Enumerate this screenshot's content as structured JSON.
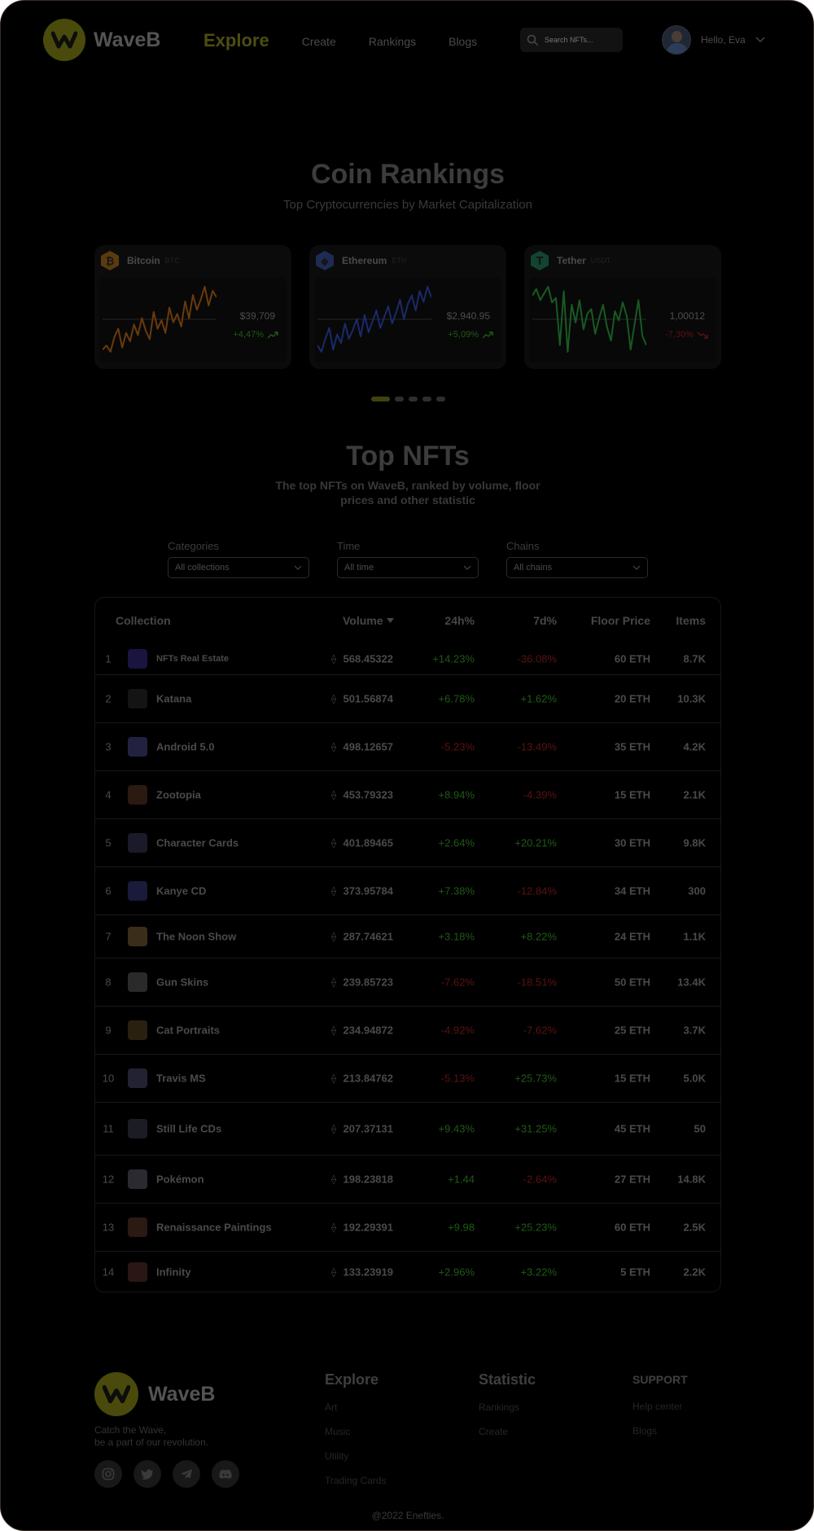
{
  "brand": {
    "name": "WaveB"
  },
  "nav": {
    "items": [
      {
        "label": "Explore",
        "active": true
      },
      {
        "label": "Create",
        "active": false
      },
      {
        "label": "Rankings",
        "active": false
      },
      {
        "label": "Blogs",
        "active": false
      }
    ],
    "search_placeholder": "Search NFTs..."
  },
  "user": {
    "greeting": "Hello, Eva"
  },
  "coin_section": {
    "title": "Coin Rankings",
    "subtitle": "Top Cryptocurrencies by Market Capitalization"
  },
  "coins": [
    {
      "name": "Bitcoin",
      "symbol": "BTC",
      "icon": "bitcoin-icon",
      "price": "$39,709",
      "change": "+4,47%",
      "direction": "up",
      "color": "#6a3a0c",
      "icon_bg": "#5a3a0e",
      "icon_glyph": "₿",
      "spark": [
        10,
        14,
        8,
        22,
        30,
        12,
        26,
        18,
        34,
        24,
        40,
        28,
        20,
        46,
        30,
        38,
        26,
        50,
        36,
        44,
        32,
        56,
        40,
        62,
        48,
        58,
        70,
        52,
        66,
        60
      ]
    },
    {
      "name": "Ethereum",
      "symbol": "ETH",
      "icon": "ethereum-icon",
      "price": "$2,940.95",
      "change": "+5,09%",
      "direction": "up",
      "color": "#1a2a6a",
      "icon_bg": "#1f2a55",
      "icon_glyph": "◆",
      "spark": [
        14,
        8,
        20,
        30,
        10,
        24,
        16,
        34,
        20,
        28,
        38,
        22,
        42,
        26,
        36,
        46,
        30,
        40,
        50,
        34,
        44,
        56,
        38,
        52,
        60,
        46,
        64,
        54,
        68,
        58
      ]
    },
    {
      "name": "Tether",
      "symbol": "USDT",
      "icon": "tether-icon",
      "price": "1,00012",
      "change": "-7,30%",
      "direction": "down",
      "color": "#175a24",
      "icon_bg": "#124431",
      "icon_glyph": "T",
      "spark": [
        64,
        70,
        60,
        66,
        72,
        58,
        62,
        20,
        68,
        14,
        56,
        40,
        60,
        34,
        48,
        52,
        30,
        44,
        56,
        36,
        24,
        50,
        42,
        58,
        46,
        16,
        38,
        60,
        28,
        20
      ]
    }
  ],
  "carousel": {
    "pages": 5,
    "active": 0
  },
  "nft_section": {
    "title": "Top NFTs",
    "subtitle_line1": "The top NFTs on WaveB, ranked by volume, floor",
    "subtitle_line2": "prices and other statistic"
  },
  "filters": [
    {
      "label": "Categories",
      "value": "All collections"
    },
    {
      "label": "Time",
      "value": "All time"
    },
    {
      "label": "Chains",
      "value": "All chains"
    }
  ],
  "table": {
    "headers": {
      "collection": "Collection",
      "volume": "Volume",
      "h24": "24h%",
      "d7": "7d%",
      "floor": "Floor Price",
      "items": "Items"
    },
    "rows": [
      {
        "rank": "1",
        "name": "NFTs Real Estate",
        "volume": "568.45322",
        "h24": "+14.23%",
        "d7": "-36.08%",
        "floor": "60 ETH",
        "items": "8.7K",
        "thumb": "#1a1440"
      },
      {
        "rank": "2",
        "name": "Katana",
        "volume": "501.56874",
        "h24": "+6.78%",
        "d7": "+1.62%",
        "floor": "20 ETH",
        "items": "10.3K",
        "thumb": "#141414"
      },
      {
        "rank": "3",
        "name": "Android 5.0",
        "volume": "498.12657",
        "h24": "-5.23%",
        "d7": "-13.49%",
        "floor": "35 ETH",
        "items": "4.2K",
        "thumb": "#222240"
      },
      {
        "rank": "4",
        "name": "Zootopia",
        "volume": "453.79323",
        "h24": "+8.94%",
        "d7": "-4.39%",
        "floor": "15 ETH",
        "items": "2.1K",
        "thumb": "#2a1a10"
      },
      {
        "rank": "5",
        "name": "Character Cards",
        "volume": "401.89465",
        "h24": "+2.64%",
        "d7": "+20.21%",
        "floor": "30 ETH",
        "items": "9.8K",
        "thumb": "#1a1a2a"
      },
      {
        "rank": "6",
        "name": "Kanye CD",
        "volume": "373.95784",
        "h24": "+7.38%",
        "d7": "-12.84%",
        "floor": "34 ETH",
        "items": "300",
        "thumb": "#1a1a3a"
      },
      {
        "rank": "7",
        "name": "The Noon Show",
        "volume": "287.74621",
        "h24": "+3.18%",
        "d7": "+8.22%",
        "floor": "24 ETH",
        "items": "1.1K",
        "thumb": "#3a2e1a"
      },
      {
        "rank": "8",
        "name": "Gun Skins",
        "volume": "239.85723",
        "h24": "-7.62%",
        "d7": "-18.51%",
        "floor": "50 ETH",
        "items": "13.4K",
        "thumb": "#2a2a2a"
      },
      {
        "rank": "9",
        "name": "Cat Portraits",
        "volume": "234.94872",
        "h24": "-4.92%",
        "d7": "-7.62%",
        "floor": "25 ETH",
        "items": "3.7K",
        "thumb": "#2a2010"
      },
      {
        "rank": "10",
        "name": "Travis MS",
        "volume": "213.84762",
        "h24": "-5.13%",
        "d7": "+25.73%",
        "floor": "15 ETH",
        "items": "5.0K",
        "thumb": "#222232"
      },
      {
        "rank": "11",
        "name": "Still Life CDs",
        "volume": "207.37131",
        "h24": "+9.43%",
        "d7": "+31.25%",
        "floor": "45 ETH",
        "items": "50",
        "thumb": "#1c1c24"
      },
      {
        "rank": "12",
        "name": "Pokémon",
        "volume": "198.23818",
        "h24": "+1.44",
        "d7": "-2.64%",
        "floor": "27 ETH",
        "items": "14.8K",
        "thumb": "#2a2a30"
      },
      {
        "rank": "13",
        "name": "Renaissance Paintings",
        "volume": "192.29391",
        "h24": "+9.98",
        "d7": "+25.23%",
        "floor": "60 ETH",
        "items": "2.5K",
        "thumb": "#2a1a12"
      },
      {
        "rank": "14",
        "name": "Infinity",
        "volume": "133.23919",
        "h24": "+2.96%",
        "d7": "+3.22%",
        "floor": "5 ETH",
        "items": "2.2K",
        "thumb": "#2a1614"
      }
    ]
  },
  "footer": {
    "brand": "WaveB",
    "tagline_line1": "Catch the Wave,",
    "tagline_line2": "be a part of our revolution.",
    "socials": [
      "instagram-icon",
      "twitter-icon",
      "telegram-icon",
      "discord-icon"
    ],
    "columns": [
      {
        "title": "Explore",
        "links": [
          "Art",
          "Music",
          "Utility",
          "Trading Cards"
        ]
      },
      {
        "title": "Statistic",
        "links": [
          "Rankings",
          "Create"
        ]
      },
      {
        "title": "SUPPORT",
        "links": [
          "Help center",
          "Blogs"
        ]
      }
    ],
    "copyright": "@2022 Enefties."
  },
  "colors": {
    "background": "#000000",
    "positive": "#1f5a16",
    "negative": "#5a1212",
    "accent": "#4d4d14"
  }
}
